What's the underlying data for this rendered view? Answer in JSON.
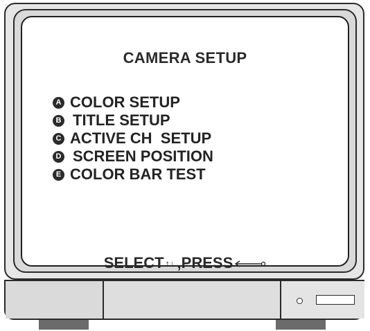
{
  "screen": {
    "title": "CAMERA SETUP",
    "menu": [
      {
        "key": "A",
        "label": "COLOR SETUP"
      },
      {
        "key": "B",
        "label": "TITLE SETUP"
      },
      {
        "key": "C",
        "label": "ACTIVE CH  SETUP"
      },
      {
        "key": "D",
        "label": "SCREEN POSITION"
      },
      {
        "key": "E",
        "label": "COLOR BAR TEST"
      }
    ],
    "footer": {
      "select_label": "SELECT",
      "arrows": "↑↓",
      "press_label": ",PRESS"
    }
  },
  "icons": {
    "enter": "enter-arrow-icon",
    "power": "power-led-icon"
  },
  "colors": {
    "screen_bg": "#ffffff",
    "bezel": "#d9d9d9",
    "outline": "#2a2a2a"
  }
}
